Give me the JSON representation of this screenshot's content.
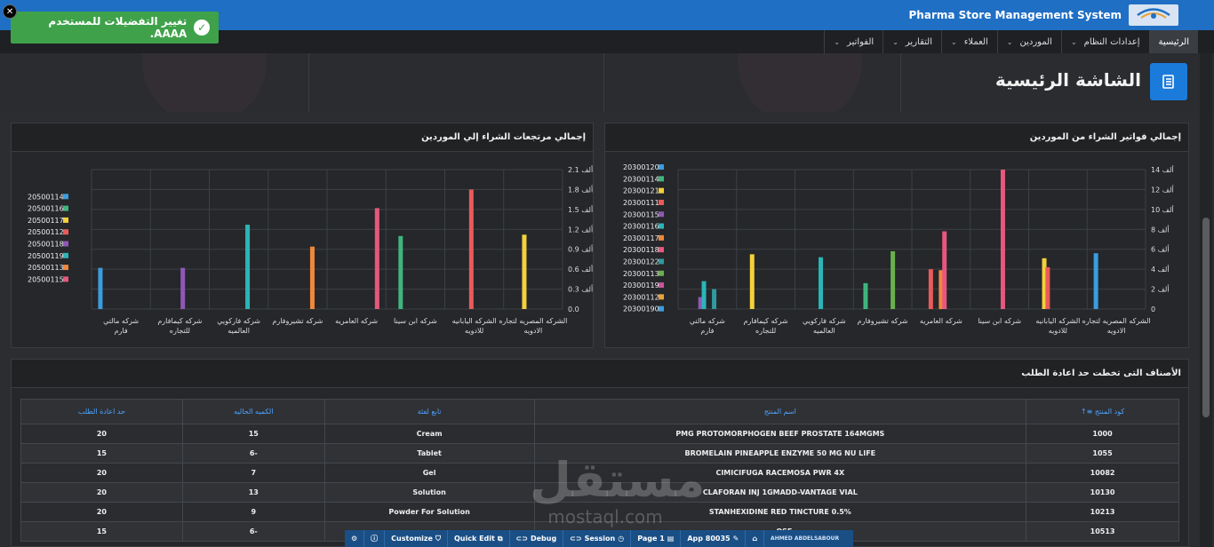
{
  "header": {
    "app_title": "Pharma Store Management System"
  },
  "nav": {
    "items": [
      {
        "label": "الرئيسية",
        "caret": false,
        "active": true
      },
      {
        "label": "إعدادات النظام",
        "caret": true
      },
      {
        "label": "الموردين",
        "caret": true
      },
      {
        "label": "العملاء",
        "caret": true
      },
      {
        "label": "التقارير",
        "caret": true
      },
      {
        "label": "الفواتير",
        "caret": true
      }
    ]
  },
  "toast": {
    "message": "تغيير التفضيلات للمستخدم AAAA."
  },
  "page": {
    "title": "الشاشة الرئيسية"
  },
  "chart_left_title": "إجمالي مرتجعات الشراء إلي الموردين",
  "chart_right_title": "إجمالي فواتير الشراء من الموردين",
  "table": {
    "title": "الأصناف التى تخطت حد اعادة الطلب",
    "columns": [
      "كود المنتج",
      "اسم المنتج",
      "تابع لفئة",
      "الكميه الحاليه",
      "حد اعادة الطلب"
    ],
    "rows": [
      [
        "1000",
        "PMG PROTOMORPHOGEN BEEF PROSTATE 164MGMS",
        "Cream",
        "15",
        "20"
      ],
      [
        "1055",
        "BROMELAIN PINEAPPLE ENZYME 50 MG NU LIFE",
        "Tablet",
        "6-",
        "15"
      ],
      [
        "10082",
        "CIMICIFUGA RACEMOSA PWR 4X",
        "Gel",
        "7",
        "20"
      ],
      [
        "10130",
        "CLAFORAN INJ 1GMADD-VANTAGE VIAL",
        "Solution",
        "13",
        "20"
      ],
      [
        "10213",
        "STANHEXIDINE RED TINCTURE 0.5%",
        "Powder For Solution",
        "9",
        "20"
      ],
      [
        "10513",
        "...OSE",
        "",
        "6-",
        "15"
      ]
    ]
  },
  "devbar": {
    "customize": "Customize",
    "quick_edit": "Quick Edit",
    "debug": "Debug",
    "session": "Session",
    "page": "Page 1",
    "app": "App 80035",
    "user": "AHMED ABDELSABOUR"
  },
  "watermark": {
    "ar": "مستقل",
    "en": "mostaql.com"
  },
  "chart_data": [
    {
      "type": "bar",
      "title": "إجمالي مرتجعات الشراء إلي الموردين",
      "categories": [
        "الشركه المصريه لتجاره الادويه",
        "الشركه اليابانيه للادويه",
        "شركه ابن سينا",
        "شركه العامريه",
        "شركه تشيروفارم",
        "شركه فاركويي العالميه",
        "شركه كيمافارم للتجاره",
        "شركه مالتي فارم"
      ],
      "ytick_labels": [
        "0.0",
        "0.3 ألف",
        "0.6 ألف",
        "0.9 ألف",
        "1.2 ألف",
        "1.5 ألف",
        "1.8 ألف",
        "2.1 ألف"
      ],
      "ylim": [
        0,
        2100
      ],
      "series": [
        {
          "name": "20500114",
          "color": "#3b9de0",
          "values": [
            null,
            null,
            null,
            null,
            null,
            null,
            null,
            620
          ]
        },
        {
          "name": "20500116",
          "color": "#3fb57d",
          "values": [
            null,
            null,
            1100,
            null,
            null,
            null,
            null,
            null
          ]
        },
        {
          "name": "20500117",
          "color": "#f4d13a",
          "values": [
            1120,
            null,
            null,
            null,
            null,
            null,
            null,
            null
          ]
        },
        {
          "name": "20500112",
          "color": "#ea5a5a",
          "values": [
            null,
            1800,
            null,
            null,
            null,
            null,
            null,
            null
          ]
        },
        {
          "name": "20500118",
          "color": "#8e58b6",
          "values": [
            null,
            null,
            null,
            null,
            null,
            null,
            620,
            null
          ]
        },
        {
          "name": "20500119",
          "color": "#2bb5b8",
          "values": [
            null,
            null,
            null,
            null,
            null,
            1270,
            null,
            null
          ]
        },
        {
          "name": "20500113",
          "color": "#f0883a",
          "values": [
            null,
            null,
            null,
            null,
            940,
            null,
            null,
            null
          ]
        },
        {
          "name": "20500115",
          "color": "#e8577d",
          "values": [
            null,
            null,
            null,
            1520,
            null,
            null,
            null,
            null
          ]
        }
      ]
    },
    {
      "type": "bar",
      "title": "إجمالي فواتير الشراء من الموردين",
      "categories": [
        "الشركه المصريه لتجاره الادويه",
        "الشركه اليابانيه للادويه",
        "شركه ابن سينا",
        "شركه العامريه",
        "شركه تشيروفارم",
        "شركه فاركويي العالميه",
        "شركه كيمافارم للتجاره",
        "شركه مالتي فارم"
      ],
      "ytick_labels": [
        "0",
        "2 ألف",
        "4 ألف",
        "6 ألف",
        "8 ألف",
        "10 ألف",
        "12 ألف",
        "14 ألف"
      ],
      "ylim": [
        0,
        14000
      ],
      "series": [
        {
          "name": "20300120",
          "color": "#3b9de0",
          "values": [
            5600,
            null,
            null,
            null,
            null,
            null,
            null,
            null
          ]
        },
        {
          "name": "20300114",
          "color": "#3fb57d",
          "values": [
            null,
            null,
            null,
            null,
            2600,
            null,
            null,
            null
          ]
        },
        {
          "name": "20300121",
          "color": "#f4d13a",
          "values": [
            null,
            5100,
            null,
            null,
            null,
            null,
            5500,
            null
          ]
        },
        {
          "name": "20300111",
          "color": "#ea5a5a",
          "values": [
            null,
            4200,
            null,
            4000,
            null,
            null,
            null,
            null
          ]
        },
        {
          "name": "20300115",
          "color": "#8e58b6",
          "values": [
            null,
            null,
            null,
            null,
            null,
            null,
            null,
            1200
          ]
        },
        {
          "name": "20300116",
          "color": "#2bb5b8",
          "values": [
            null,
            null,
            null,
            null,
            null,
            5200,
            null,
            2800
          ]
        },
        {
          "name": "20300117",
          "color": "#f0883a",
          "values": [
            null,
            null,
            null,
            3900,
            null,
            null,
            null,
            null
          ]
        },
        {
          "name": "20300118",
          "color": "#e8577d",
          "values": [
            null,
            null,
            14000,
            7800,
            null,
            null,
            null,
            null
          ]
        },
        {
          "name": "20300122",
          "color": "#2f9aa0",
          "values": [
            null,
            null,
            null,
            null,
            null,
            null,
            null,
            2000
          ]
        },
        {
          "name": "20300113",
          "color": "#6ab04c",
          "values": [
            null,
            null,
            null,
            null,
            5800,
            null,
            null,
            null
          ]
        },
        {
          "name": "20300119",
          "color": "#c9559a",
          "values": [
            null,
            null,
            null,
            null,
            null,
            null,
            null,
            null
          ]
        },
        {
          "name": "20300112",
          "color": "#e8a33a",
          "values": [
            null,
            null,
            null,
            null,
            null,
            null,
            null,
            null
          ]
        },
        {
          "name": "20300190",
          "color": "#3b9de0",
          "values": [
            null,
            null,
            null,
            null,
            null,
            null,
            null,
            null
          ]
        }
      ]
    }
  ]
}
